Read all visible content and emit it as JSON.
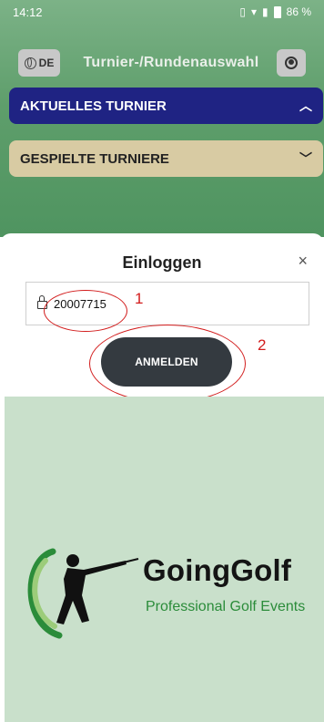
{
  "status_bar": {
    "time": "14:12",
    "battery": "86 %"
  },
  "header": {
    "language_label": "DE",
    "title": "Turnier-/Rundenauswahl"
  },
  "panels": {
    "current_tournament": "AKTUELLES TURNIER",
    "played_tournaments": "GESPIELTE TURNIERE"
  },
  "login_modal": {
    "title": "Einloggen",
    "close_symbol": "×",
    "id_value": "20007715",
    "button_label": "ANMELDEN"
  },
  "annotations": {
    "first": "1",
    "second": "2"
  },
  "brand": {
    "name": "GoingGolf",
    "tagline": "Professional Golf Events"
  },
  "colors": {
    "current_panel": "#1f2383",
    "played_panel": "#d8cba3",
    "login_button": "#343a40",
    "annotation": "#d21c1c",
    "brand_green": "#2b8c3a"
  }
}
